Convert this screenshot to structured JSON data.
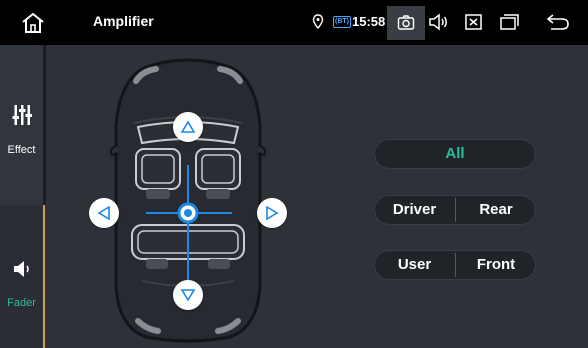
{
  "statusbar": {
    "title": "Amplifier",
    "bt_badge": "(BT)",
    "time": "15:58"
  },
  "sidebar": {
    "tabs": [
      {
        "label": "Effect",
        "icon": "equalizer-icon",
        "active": false
      },
      {
        "label": "Fader",
        "icon": "speaker-icon",
        "active": true
      }
    ]
  },
  "presets": {
    "all": "All",
    "driver": "Driver",
    "rear": "Rear",
    "user": "User",
    "front": "Front"
  },
  "colors": {
    "accent": "#2dbd9a",
    "fader_point": "#1e88e5",
    "divider": "#c9a24a"
  }
}
